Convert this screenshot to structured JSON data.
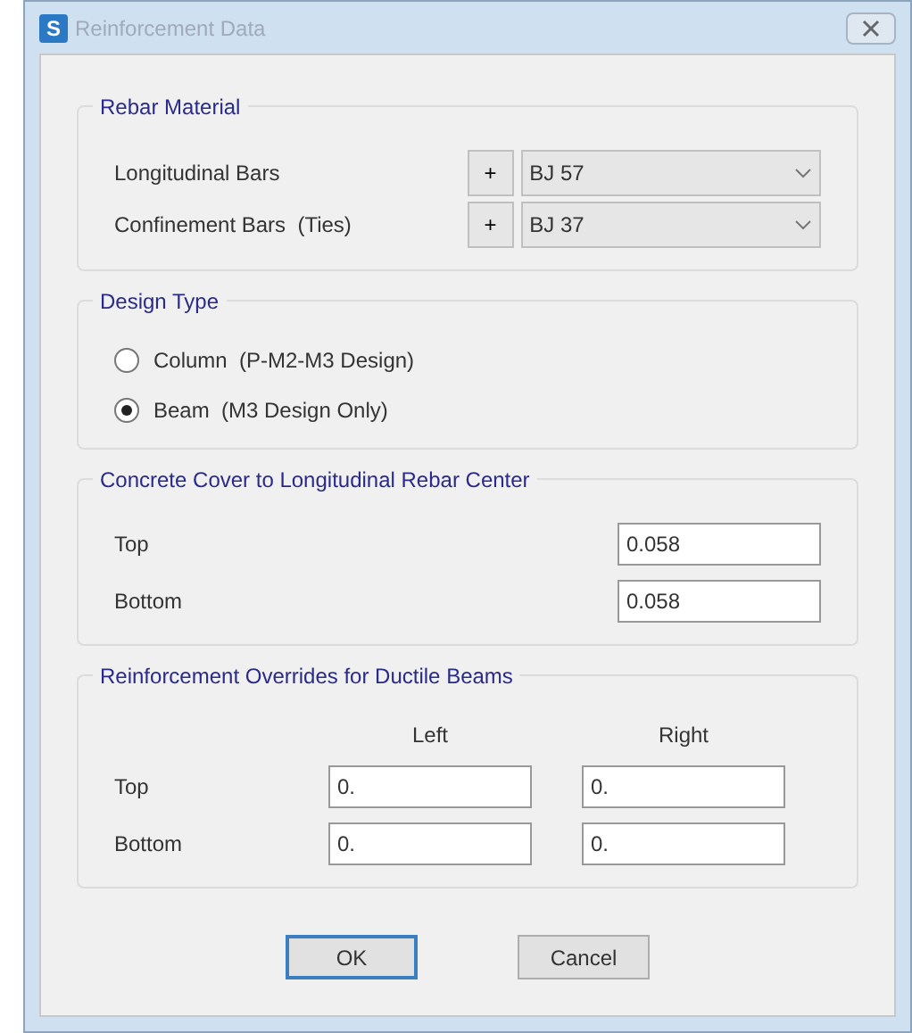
{
  "window": {
    "app_letter": "S",
    "title": "Reinforcement Data"
  },
  "rebar_material": {
    "title": "Rebar Material",
    "rows": [
      {
        "label": "Longitudinal Bars",
        "add": "+",
        "value": "BJ 57"
      },
      {
        "label": "Confinement Bars  (Ties)",
        "add": "+",
        "value": "BJ 37"
      }
    ]
  },
  "design_type": {
    "title": "Design Type",
    "options": [
      {
        "label": "Column  (P-M2-M3 Design)",
        "selected": false
      },
      {
        "label": "Beam  (M3 Design Only)",
        "selected": true
      }
    ]
  },
  "concrete_cover": {
    "title": "Concrete Cover to Longitudinal Rebar Center",
    "rows": [
      {
        "label": "Top",
        "value": "0.058"
      },
      {
        "label": "Bottom",
        "value": "0.058"
      }
    ]
  },
  "overrides": {
    "title": "Reinforcement Overrides for Ductile Beams",
    "columns": [
      "Left",
      "Right"
    ],
    "rows": [
      {
        "label": "Top",
        "values": [
          "0.",
          "0."
        ]
      },
      {
        "label": "Bottom",
        "values": [
          "0.",
          "0."
        ]
      }
    ]
  },
  "buttons": [
    {
      "label": "OK",
      "default": true
    },
    {
      "label": "Cancel",
      "default": false
    }
  ]
}
